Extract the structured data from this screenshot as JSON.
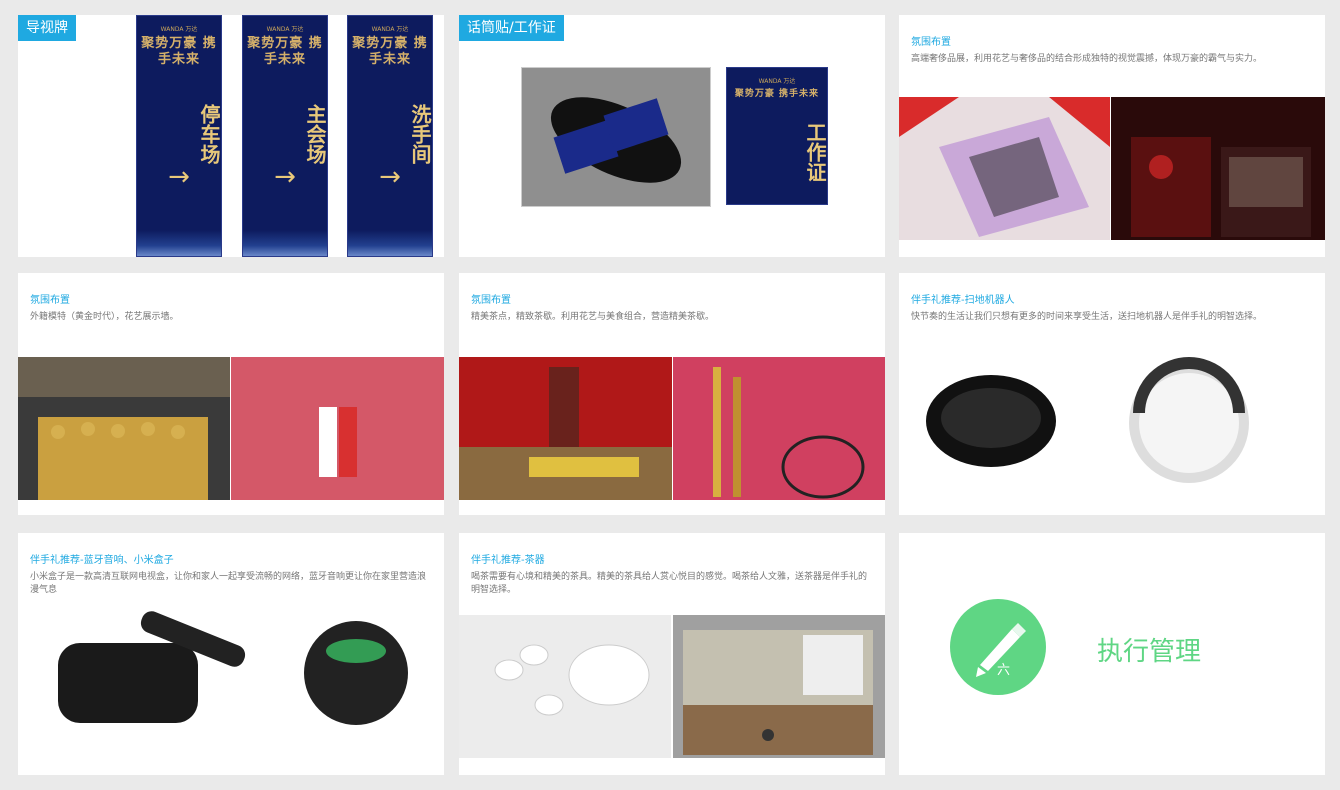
{
  "cards": {
    "c1": {
      "tag": "导视牌",
      "banners": [
        {
          "logo": "WANDA 万达",
          "slogan": "聚势万豪 携手未来",
          "place": "停车场",
          "arrow": "→"
        },
        {
          "logo": "WANDA 万达",
          "slogan": "聚势万豪 携手未来",
          "place": "主会场",
          "arrow": "→"
        },
        {
          "logo": "WANDA 万达",
          "slogan": "聚势万豪 携手未来",
          "place": "洗手间",
          "arrow": "→"
        }
      ]
    },
    "c2": {
      "tag": "话筒贴/工作证",
      "badge_slogan": "聚势万豪 携手未来",
      "badge_word": "工作证",
      "badge_logo": "WANDA 万达"
    },
    "c3": {
      "title": "氛围布置",
      "text": "高端奢侈品展，利用花艺与奢侈品的结合形成独特的视觉震撼，体现万豪的霸气与实力。"
    },
    "c4": {
      "title": "氛围布置",
      "text": "外籍模特（黄金时代），花艺展示墙。"
    },
    "c5": {
      "title": "氛围布置",
      "text": "精美茶点，精致茶歇。利用花艺与美食组合，营造精美茶歇。"
    },
    "c6": {
      "title": "伴手礼推荐-扫地机器人",
      "text": "快节奏的生活让我们只想有更多的时间来享受生活，送扫地机器人是伴手礼的明智选择。"
    },
    "c7": {
      "title": "伴手礼推荐-蓝牙音响、小米盒子",
      "text": "小米盒子是一款高清互联网电视盒，让你和家人一起享受流畅的网络，蓝牙音响更让你在家里营造浪漫气息"
    },
    "c8": {
      "title": "伴手礼推荐-茶器",
      "text": "喝茶需要有心境和精美的茶具。精美的茶具给人赏心悦目的感觉。喝茶给人文雅，送茶器是伴手礼的明智选择。"
    },
    "c9": {
      "number": "六",
      "label": "执行管理"
    }
  },
  "colors": {
    "accent": "#1fa9e1",
    "green": "#5fd684",
    "navy": "#0d1b5e",
    "gold": "#d4b06a"
  }
}
